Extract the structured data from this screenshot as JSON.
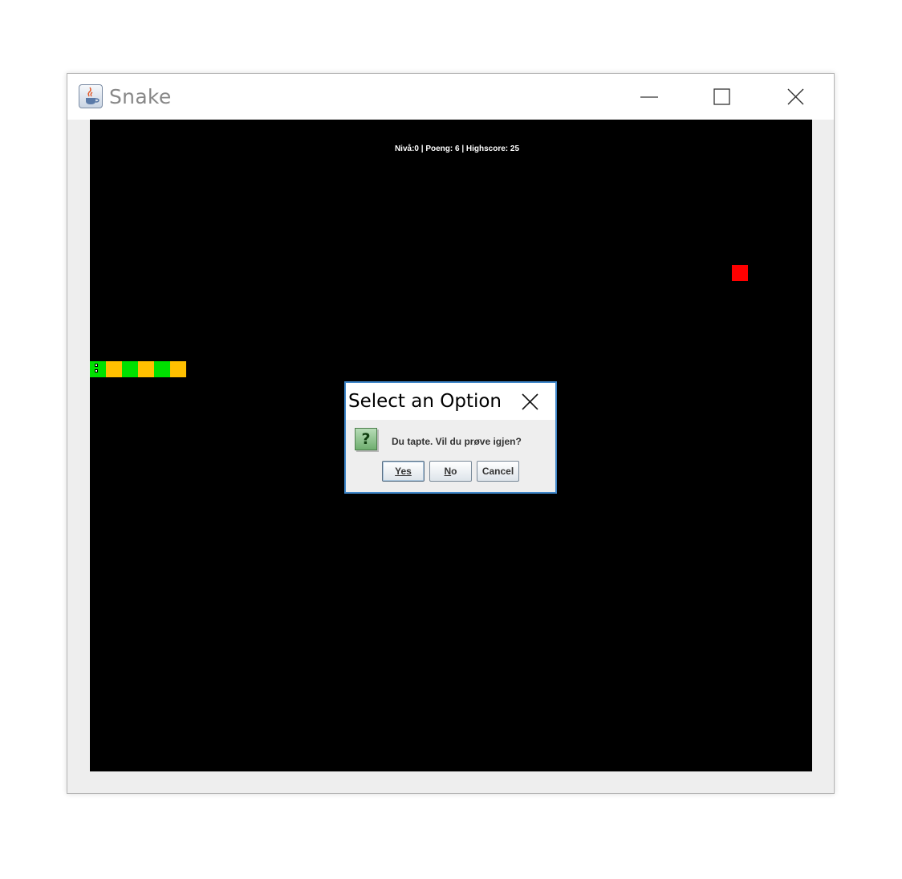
{
  "window": {
    "title": "Snake",
    "icon": "java-coffee-icon",
    "controls": [
      "minimize-icon",
      "maximize-icon",
      "close-icon"
    ]
  },
  "game": {
    "hud": "Nivå:0 | Poeng: 6 | Highscore: 25",
    "background": "#000000",
    "colors": {
      "snake_green": "#00e000",
      "snake_yellow": "#ffc000",
      "food": "#ff0000"
    }
  },
  "dialog": {
    "title": "Select an Option",
    "icon": "question-icon",
    "question_glyph": "?",
    "message": "Du tapte. Vil du prøve igjen?",
    "buttons": {
      "yes_mnemonic": "Y",
      "yes_rest": "es",
      "no_mnemonic": "N",
      "no_rest": "o",
      "cancel": "Cancel"
    }
  }
}
